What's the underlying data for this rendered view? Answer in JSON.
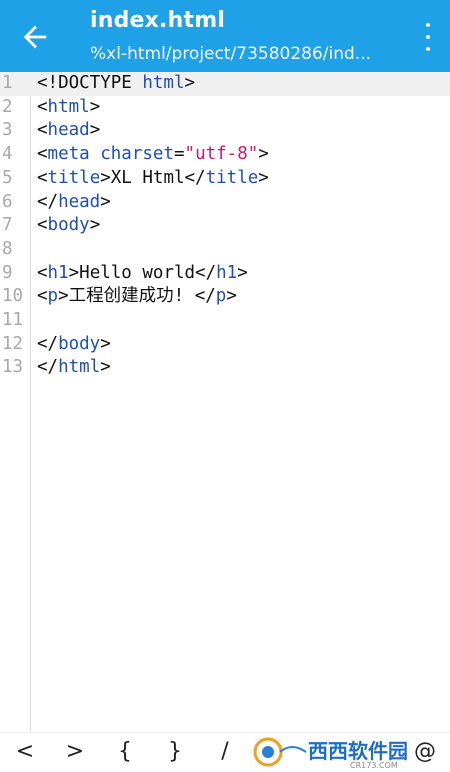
{
  "appbar": {
    "title": "index.html",
    "subtitle": "%xl-html/project/73580286/ind...",
    "back_icon": "arrow-left-icon",
    "menu_icon": "more-vert-icon",
    "color": "#1ea1e6"
  },
  "editor": {
    "current_line": 1,
    "lines": [
      {
        "n": "1",
        "parts": [
          {
            "t": "<!DOCTYPE ",
            "c": "plain"
          },
          {
            "t": "html",
            "c": "kw"
          },
          {
            "t": ">",
            "c": "plain"
          }
        ]
      },
      {
        "n": "2",
        "parts": [
          {
            "t": "<",
            "c": "plain"
          },
          {
            "t": "html",
            "c": "kw"
          },
          {
            "t": ">",
            "c": "plain"
          }
        ]
      },
      {
        "n": "3",
        "parts": [
          {
            "t": "<",
            "c": "plain"
          },
          {
            "t": "head",
            "c": "kw"
          },
          {
            "t": ">",
            "c": "plain"
          }
        ]
      },
      {
        "n": "4",
        "parts": [
          {
            "t": "<",
            "c": "plain"
          },
          {
            "t": "meta charset",
            "c": "kw"
          },
          {
            "t": "=",
            "c": "plain"
          },
          {
            "t": "\"utf-8\"",
            "c": "str"
          },
          {
            "t": ">",
            "c": "plain"
          }
        ]
      },
      {
        "n": "5",
        "parts": [
          {
            "t": "<",
            "c": "plain"
          },
          {
            "t": "title",
            "c": "kw"
          },
          {
            "t": ">XL Html</",
            "c": "plain"
          },
          {
            "t": "title",
            "c": "kw"
          },
          {
            "t": ">",
            "c": "plain"
          }
        ]
      },
      {
        "n": "6",
        "parts": [
          {
            "t": "</",
            "c": "plain"
          },
          {
            "t": "head",
            "c": "kw"
          },
          {
            "t": ">",
            "c": "plain"
          }
        ]
      },
      {
        "n": "7",
        "parts": [
          {
            "t": "<",
            "c": "plain"
          },
          {
            "t": "body",
            "c": "kw"
          },
          {
            "t": ">",
            "c": "plain"
          }
        ]
      },
      {
        "n": "8",
        "parts": []
      },
      {
        "n": "9",
        "parts": [
          {
            "t": "<",
            "c": "plain"
          },
          {
            "t": "h1",
            "c": "kw"
          },
          {
            "t": ">Hello world</",
            "c": "plain"
          },
          {
            "t": "h1",
            "c": "kw"
          },
          {
            "t": ">",
            "c": "plain"
          }
        ]
      },
      {
        "n": "10",
        "parts": [
          {
            "t": "<",
            "c": "plain"
          },
          {
            "t": "p",
            "c": "kw"
          },
          {
            "t": ">工程创建成功! </",
            "c": "plain"
          },
          {
            "t": "p",
            "c": "kw"
          },
          {
            "t": ">",
            "c": "plain"
          }
        ]
      },
      {
        "n": "11",
        "parts": []
      },
      {
        "n": "12",
        "parts": [
          {
            "t": "</",
            "c": "plain"
          },
          {
            "t": "body",
            "c": "kw"
          },
          {
            "t": ">",
            "c": "plain"
          }
        ]
      },
      {
        "n": "13",
        "parts": [
          {
            "t": "</",
            "c": "plain"
          },
          {
            "t": "html",
            "c": "kw"
          },
          {
            "t": ">",
            "c": "plain"
          }
        ]
      }
    ]
  },
  "keybar": {
    "keys": [
      "<",
      ">",
      "{",
      "}",
      "/",
      "@"
    ]
  },
  "watermark": {
    "text": "西西软件园",
    "sub": "CR173.COM"
  }
}
